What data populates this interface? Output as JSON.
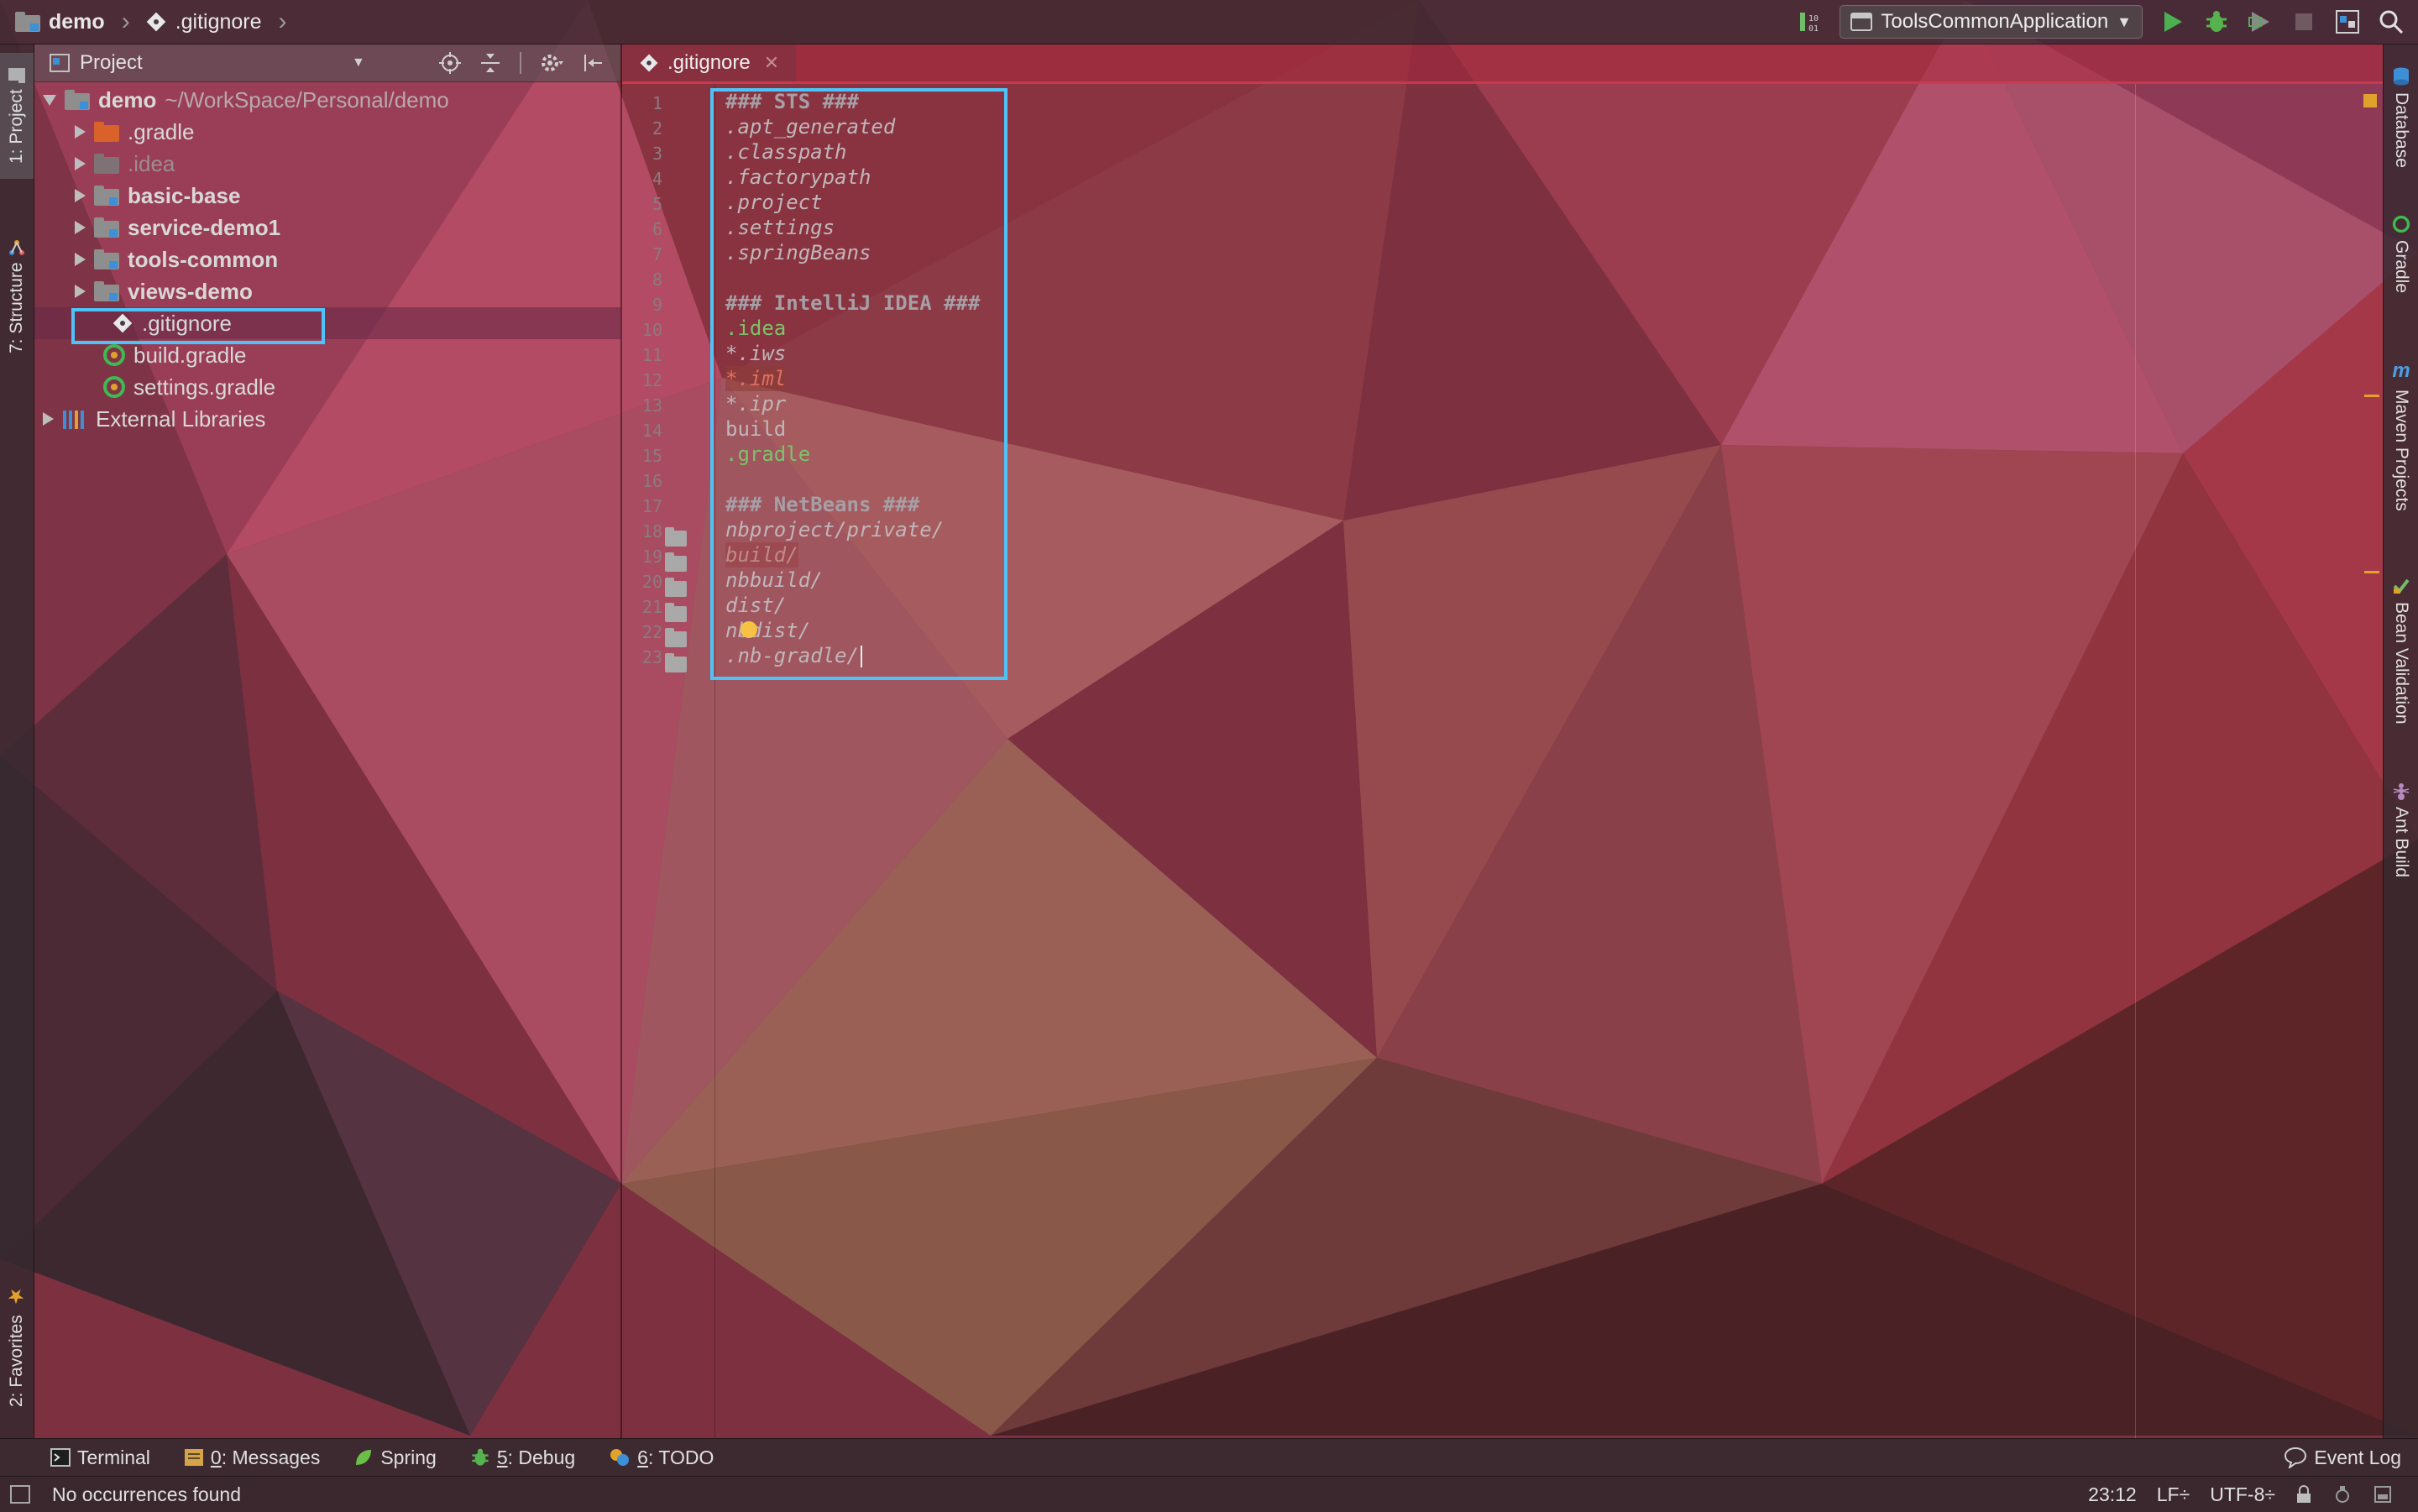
{
  "breadcrumb": {
    "project": "demo",
    "file": ".gitignore"
  },
  "toolbar": {
    "run_config": "ToolsCommonApplication"
  },
  "left_tabs": {
    "project": "1: Project",
    "structure": "7: Structure",
    "favorites": "2: Favorites"
  },
  "right_tabs": {
    "database": "Database",
    "gradle": "Gradle",
    "maven": "Maven Projects",
    "bean_validation": "Bean Validation",
    "ant": "Ant Build"
  },
  "project_panel": {
    "title": "Project",
    "root": {
      "name": "demo",
      "path": "~/WorkSpace/Personal/demo"
    },
    "items": [
      {
        "name": ".gradle"
      },
      {
        "name": ".idea"
      },
      {
        "name": "basic-base"
      },
      {
        "name": "service-demo1"
      },
      {
        "name": "tools-common"
      },
      {
        "name": "views-demo"
      },
      {
        "name": ".gitignore"
      },
      {
        "name": "build.gradle"
      },
      {
        "name": "settings.gradle"
      },
      {
        "name": "External Libraries"
      }
    ]
  },
  "editor": {
    "tab_label": ".gitignore",
    "line_numbers": [
      "1",
      "2",
      "3",
      "4",
      "5",
      "6",
      "7",
      "8",
      "9",
      "10",
      "11",
      "12",
      "13",
      "14",
      "15",
      "16",
      "17",
      "18",
      "19",
      "20",
      "21",
      "22",
      "23"
    ],
    "lines": [
      "### STS ###",
      ".apt_generated",
      ".classpath",
      ".factorypath",
      ".project",
      ".settings",
      ".springBeans",
      "",
      "### IntelliJ IDEA ###",
      ".idea",
      "*.iws",
      "*.iml",
      "*.ipr",
      "build",
      ".gradle",
      "",
      "### NetBeans ###",
      "nbproject/private/",
      "build/",
      "nbbuild/",
      "dist/",
      "nbdist/",
      ".nb-gradle/"
    ]
  },
  "bottom_bar": {
    "terminal": "Terminal",
    "messages_num": "0",
    "messages": ": Messages",
    "spring": "Spring",
    "debug_num": "5",
    "debug": ": Debug",
    "todo_num": "6",
    "todo": ": TODO",
    "event_log": "Event Log"
  },
  "status_bar": {
    "message": "No occurrences found",
    "position": "23:12",
    "line_separator": "LF÷",
    "encoding": "UTF-8÷"
  },
  "colors": {
    "highlight_box": "#4fc3f7",
    "run_green": "#4caf50",
    "gradle_green": "#3fb950",
    "folder_orange": "#d9622b",
    "folder_gray": "#8e8e8e",
    "module_blue": "#3d8fd6",
    "bulb_yellow": "#f7c244"
  }
}
